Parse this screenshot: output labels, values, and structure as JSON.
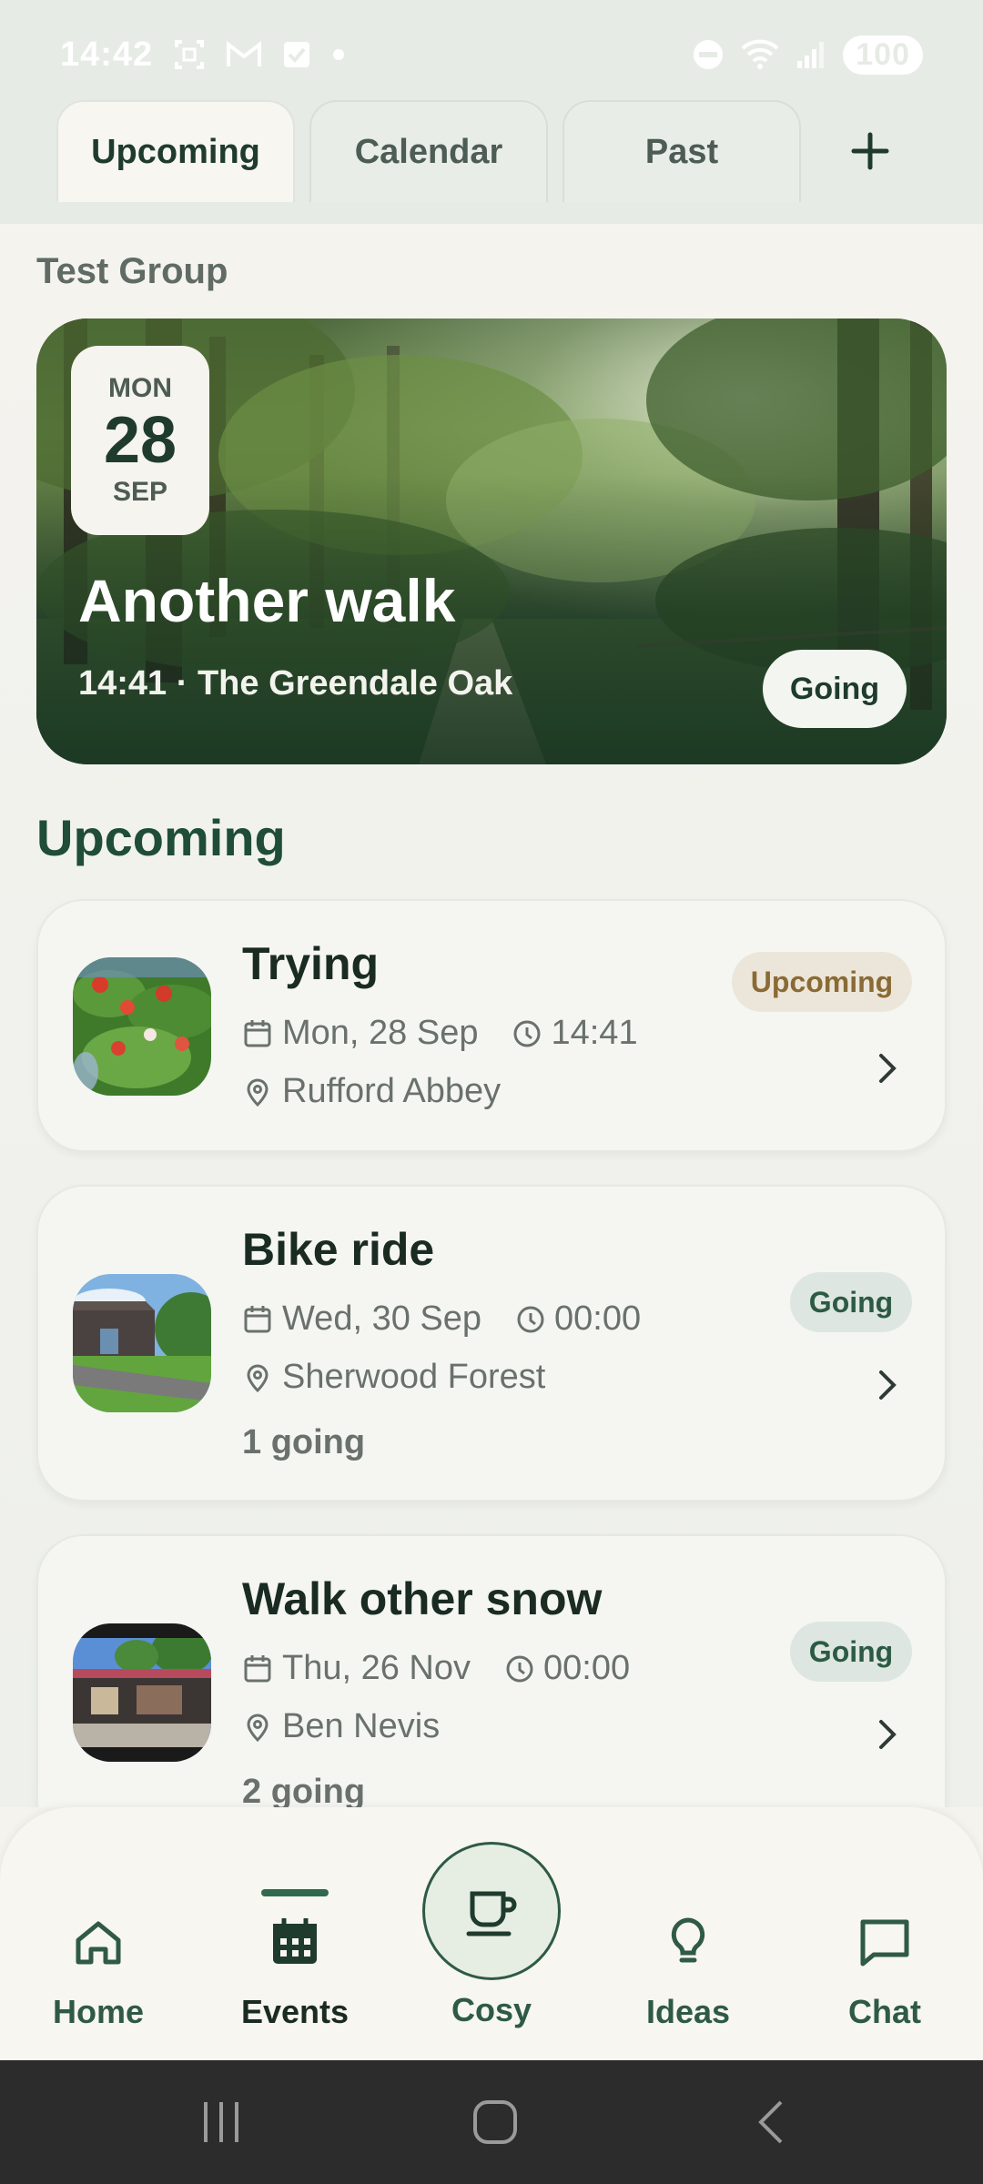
{
  "status_bar": {
    "time": "14:42",
    "battery": "100",
    "icons": [
      "screenshot-icon",
      "gmail-icon",
      "check-icon",
      "dot-icon",
      "dnd-icon",
      "wifi-icon",
      "signal-icon"
    ]
  },
  "tabs": [
    {
      "label": "Upcoming",
      "active": true
    },
    {
      "label": "Calendar",
      "active": false
    },
    {
      "label": "Past",
      "active": false
    }
  ],
  "group_name": "Test Group",
  "featured": {
    "weekday": "MON",
    "day": "28",
    "month": "SEP",
    "title": "Another walk",
    "subtitle": "14:41 · The Greendale Oak",
    "rsvp": "Going"
  },
  "section_title": "Upcoming",
  "events": [
    {
      "title": "Trying",
      "date": "Mon, 28 Sep",
      "time": "14:41",
      "location": "Rufford Abbey",
      "status": "Upcoming",
      "going": ""
    },
    {
      "title": "Bike ride",
      "date": "Wed, 30 Sep",
      "time": "00:00",
      "location": "Sherwood Forest",
      "status": "Going",
      "going": "1 going"
    },
    {
      "title": "Walk other snow",
      "date": "Thu, 26 Nov",
      "time": "00:00",
      "location": "Ben Nevis",
      "status": "Going",
      "going": "2 going"
    }
  ],
  "bottom_nav": [
    {
      "label": "Home",
      "icon": "home-icon"
    },
    {
      "label": "Events",
      "icon": "calendar-icon",
      "active": true
    },
    {
      "label": "Cosy",
      "icon": "coffee-cup-icon"
    },
    {
      "label": "Ideas",
      "icon": "lightbulb-icon"
    },
    {
      "label": "Chat",
      "icon": "chat-icon"
    }
  ],
  "colors": {
    "primary": "#1f4d38",
    "accent_green": "#2f6a4d",
    "background": "#f4f3ee",
    "upcoming_badge": "#ece6da",
    "going_badge": "#dde6e0"
  }
}
